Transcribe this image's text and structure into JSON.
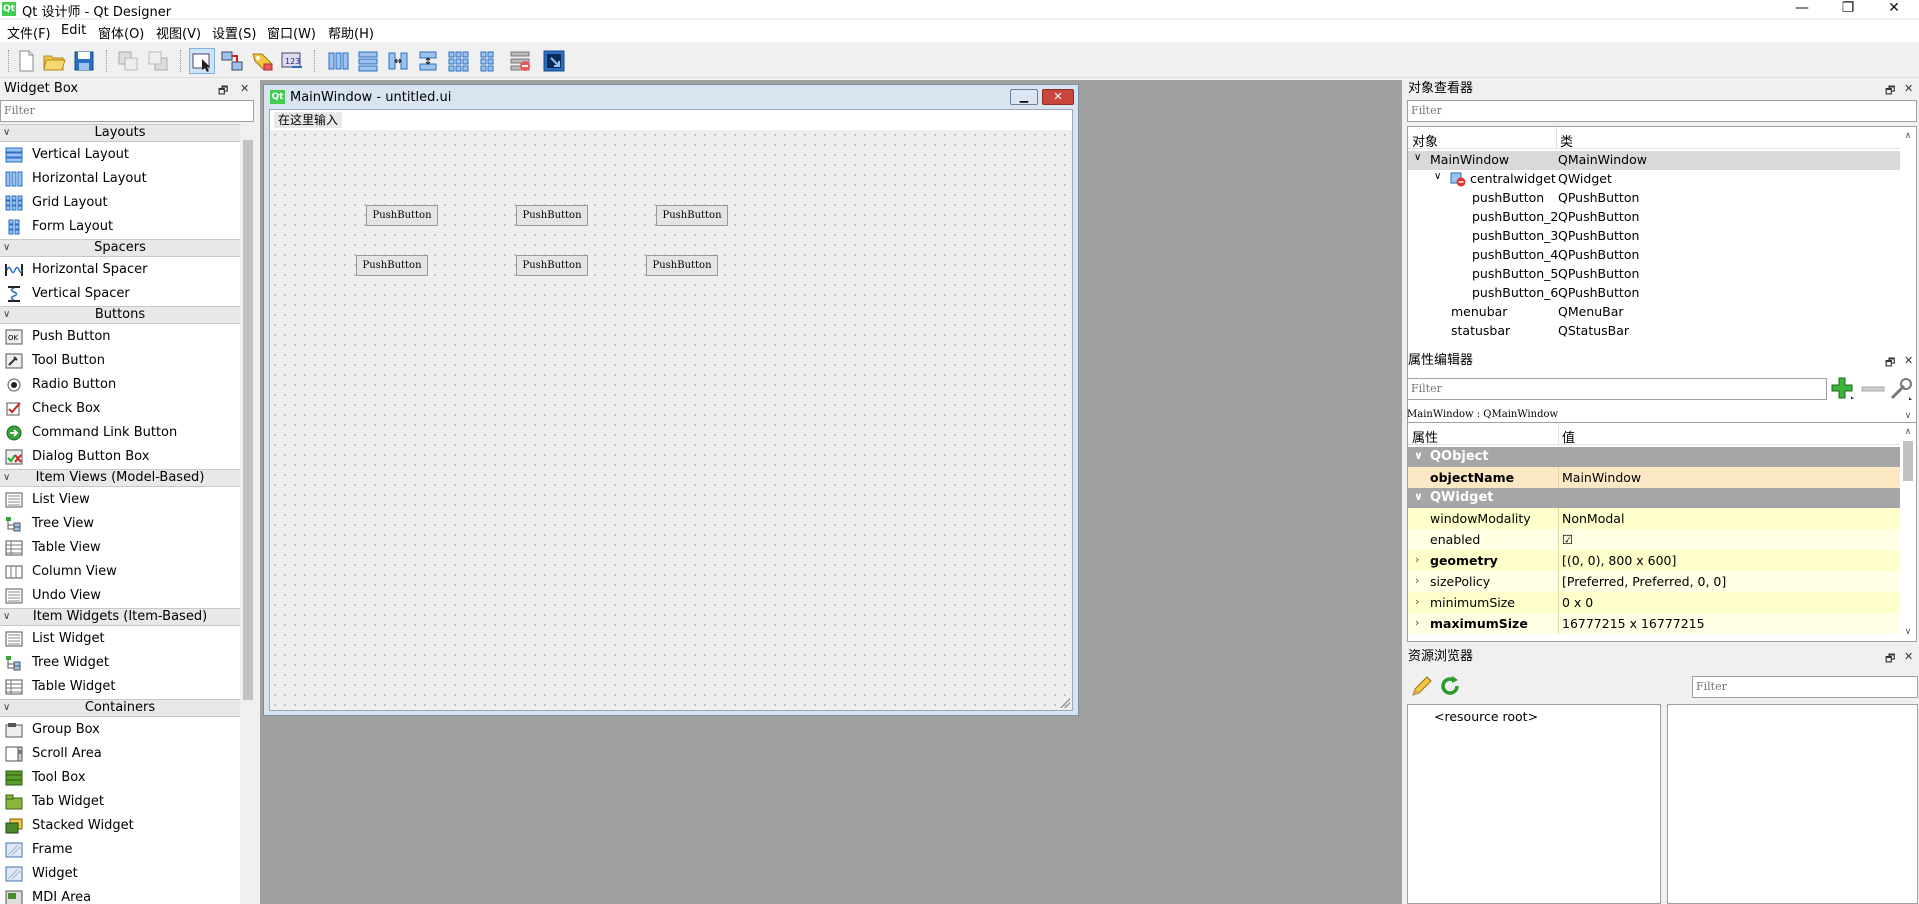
{
  "app": {
    "title": "Qt 设计师 - Qt Designer",
    "logo": "Qt",
    "controls": {
      "minimize": "—",
      "restore": "❐",
      "close": "✕"
    }
  },
  "menubar": [
    "文件(F)",
    "Edit",
    "窗体(O)",
    "视图(V)",
    "设置(S)",
    "窗口(W)",
    "帮助(H)"
  ],
  "toolbar": [
    "new-icon",
    "open-icon",
    "save-icon",
    "send-to-back-icon",
    "bring-to-front-icon",
    "edit-widgets-icon",
    "edit-signals-slots-icon",
    "edit-buddies-icon",
    "edit-tab-order-icon",
    "layout-horizontal-icon",
    "layout-vertical-icon",
    "layout-horizontal-splitter-icon",
    "layout-vertical-splitter-icon",
    "layout-grid-icon",
    "layout-form-icon",
    "break-layout-icon",
    "adjust-size-icon"
  ],
  "widget_box": {
    "title": "Widget Box",
    "filter_placeholder": "Filter",
    "dock_float": "🗗",
    "dock_close": "✕",
    "categories": [
      {
        "name": "Layouts",
        "items": [
          "Vertical Layout",
          "Horizontal Layout",
          "Grid Layout",
          "Form Layout"
        ]
      },
      {
        "name": "Spacers",
        "items": [
          "Horizontal Spacer",
          "Vertical Spacer"
        ]
      },
      {
        "name": "Buttons",
        "items": [
          "Push Button",
          "Tool Button",
          "Radio Button",
          "Check Box",
          "Command Link Button",
          "Dialog Button Box"
        ]
      },
      {
        "name": "Item Views (Model-Based)",
        "items": [
          "List View",
          "Tree View",
          "Table View",
          "Column View",
          "Undo View"
        ]
      },
      {
        "name": "Item Widgets (Item-Based)",
        "items": [
          "List Widget",
          "Tree Widget",
          "Table Widget"
        ]
      },
      {
        "name": "Containers",
        "items": [
          "Group Box",
          "Scroll Area",
          "Tool Box",
          "Tab Widget",
          "Stacked Widget",
          "Frame",
          "Widget",
          "MDI Area"
        ]
      }
    ]
  },
  "form": {
    "logo": "Qt",
    "title": "MainWindow - untitled.ui",
    "type_here": "在这里输入",
    "buttons": [
      "PushButton",
      "PushButton",
      "PushButton",
      "PushButton",
      "PushButton",
      "PushButton"
    ]
  },
  "object_inspector": {
    "title": "对象查看器",
    "filter_placeholder": "Filter",
    "col_object": "对象",
    "col_class": "类",
    "rows": [
      {
        "name": "MainWindow",
        "cls": "QMainWindow",
        "level": 0,
        "expand": "∨"
      },
      {
        "name": "centralwidget",
        "cls": "QWidget",
        "level": 1,
        "expand": "∨"
      },
      {
        "name": "pushButton",
        "cls": "QPushButton",
        "level": 2
      },
      {
        "name": "pushButton_2",
        "cls": "QPushButton",
        "level": 2
      },
      {
        "name": "pushButton_3",
        "cls": "QPushButton",
        "level": 2
      },
      {
        "name": "pushButton_4",
        "cls": "QPushButton",
        "level": 2
      },
      {
        "name": "pushButton_5",
        "cls": "QPushButton",
        "level": 2
      },
      {
        "name": "pushButton_6",
        "cls": "QPushButton",
        "level": 2
      },
      {
        "name": "menubar",
        "cls": "QMenuBar",
        "level": 1
      },
      {
        "name": "statusbar",
        "cls": "QStatusBar",
        "level": 1
      }
    ]
  },
  "property_editor": {
    "title": "属性编辑器",
    "filter_placeholder": "Filter",
    "context": "MainWindow : QMainWindow",
    "col_property": "属性",
    "col_value": "值",
    "rows": [
      {
        "kind": "group",
        "name": "QObject",
        "expand": "∨"
      },
      {
        "kind": "prop",
        "name": "objectName",
        "value": "MainWindow",
        "bold": true,
        "bg": "#fde8c6"
      },
      {
        "kind": "group",
        "name": "QWidget",
        "expand": "∨"
      },
      {
        "kind": "prop",
        "name": "windowModality",
        "value": "NonModal",
        "bg": "#ffffcc"
      },
      {
        "kind": "prop",
        "name": "enabled",
        "value": "☑",
        "bg": "#ffffe3"
      },
      {
        "kind": "prop",
        "name": "geometry",
        "value": "[(0, 0), 800 x 600]",
        "bold": true,
        "expand": "›",
        "bg": "#ffffcc"
      },
      {
        "kind": "prop",
        "name": "sizePolicy",
        "value": "[Preferred, Preferred, 0, 0]",
        "expand": "›",
        "bg": "#ffffe3"
      },
      {
        "kind": "prop",
        "name": "minimumSize",
        "value": "0 x 0",
        "expand": "›",
        "bg": "#ffffcc"
      },
      {
        "kind": "prop",
        "name": "maximumSize",
        "value": "16777215 x 16777215",
        "bold": true,
        "expand": "›",
        "bg": "#ffffe3"
      }
    ]
  },
  "resource_browser": {
    "title": "资源浏览器",
    "filter_placeholder": "Filter",
    "root": "<resource root>"
  },
  "colors": {
    "accent": "#41cd52",
    "mdi_bg": "#a0a0a0",
    "group_bg": "#a6a6a6"
  }
}
